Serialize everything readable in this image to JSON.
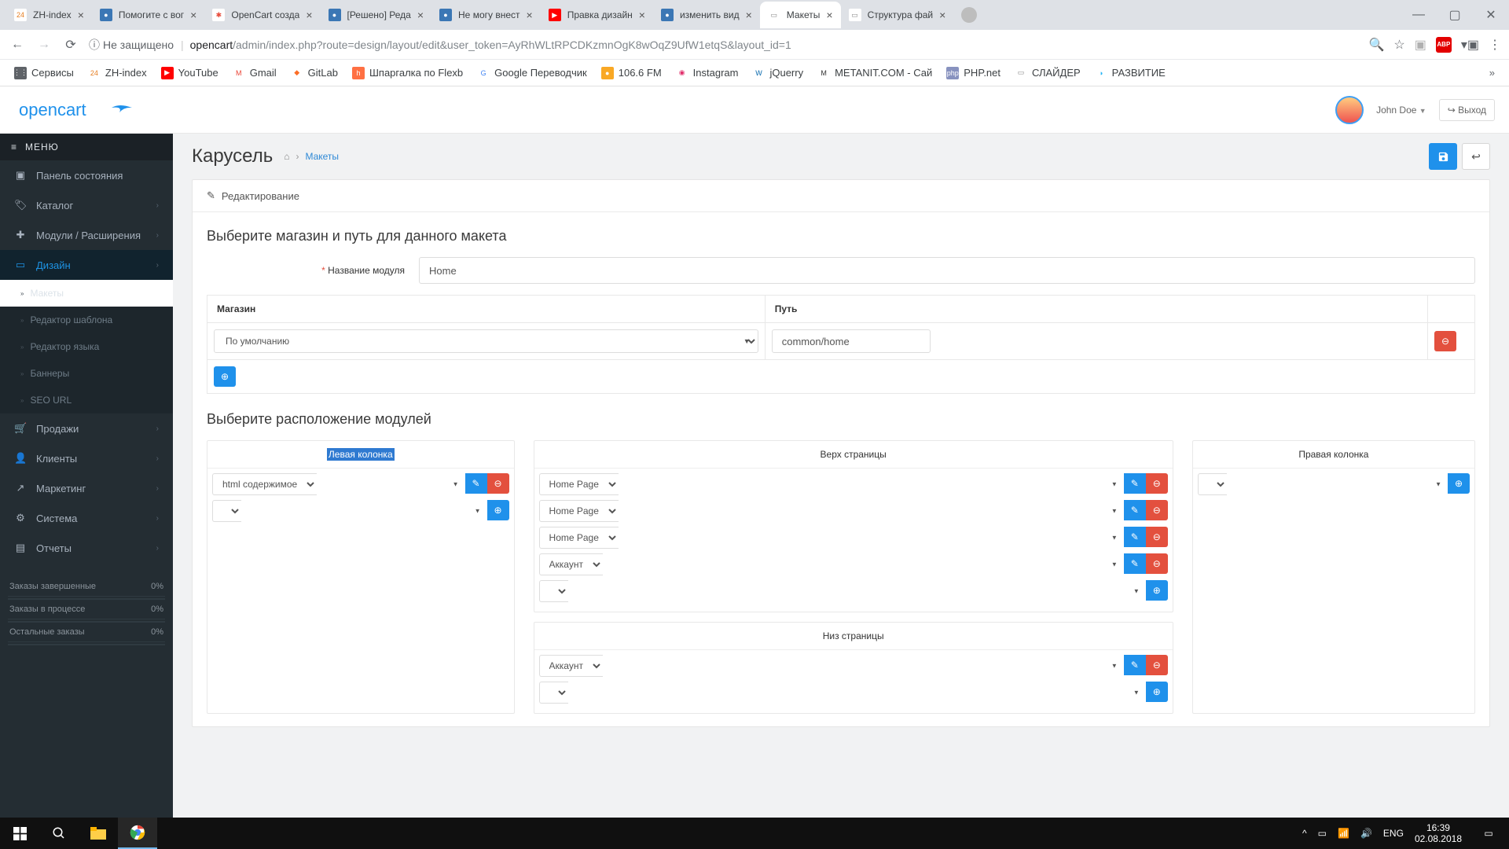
{
  "browser": {
    "tabs": [
      {
        "title": "ZH-index",
        "favBg": "#ffffff",
        "favTxt": "24",
        "favColor": "#e67e22"
      },
      {
        "title": "Помогите с вог",
        "favBg": "#3b77b5",
        "favTxt": "●",
        "favColor": "#fff"
      },
      {
        "title": "OpenCart созда",
        "favBg": "#ffffff",
        "favTxt": "✱",
        "favColor": "#e74c3c"
      },
      {
        "title": "[Решено] Реда",
        "favBg": "#3b77b5",
        "favTxt": "●",
        "favColor": "#fff"
      },
      {
        "title": "Не могу внест",
        "favBg": "#3b77b5",
        "favTxt": "●",
        "favColor": "#fff"
      },
      {
        "title": "Правка дизайн",
        "favBg": "#ff0000",
        "favTxt": "▶",
        "favColor": "#fff"
      },
      {
        "title": "изменить вид",
        "favBg": "#3b77b5",
        "favTxt": "●",
        "favColor": "#fff"
      },
      {
        "title": "Макеты",
        "favBg": "#ffffff",
        "favTxt": "▭",
        "favColor": "#888",
        "active": true
      },
      {
        "title": "Структура фай",
        "favBg": "#ffffff",
        "favTxt": "▭",
        "favColor": "#888"
      }
    ],
    "insecureLabel": "Не защищено",
    "urlHost": "opencart",
    "urlPath": "/admin/index.php?route=design/layout/edit&user_token=AyRhWLtRPCDKzmnOgK8wOqZ9UfW1etqS&layout_id=1",
    "bookmarks": [
      {
        "label": "Сервисы",
        "bg": "#5f6368",
        "txt": "⋮⋮"
      },
      {
        "label": "ZH-index",
        "bg": "#ffffff",
        "txt": "24",
        "color": "#e67e22"
      },
      {
        "label": "YouTube",
        "bg": "#ff0000",
        "txt": "▶"
      },
      {
        "label": "Gmail",
        "bg": "#ffffff",
        "txt": "M",
        "color": "#ea4335"
      },
      {
        "label": "GitLab",
        "bg": "#ffffff",
        "txt": "◆",
        "color": "#fc6d26"
      },
      {
        "label": "Шпаргалка по Flexb",
        "bg": "#ff7043",
        "txt": "h"
      },
      {
        "label": "Google Переводчик",
        "bg": "#ffffff",
        "txt": "G",
        "color": "#4285f4"
      },
      {
        "label": "106.6 FM",
        "bg": "#f9a825",
        "txt": "●"
      },
      {
        "label": "Instagram",
        "bg": "#ffffff",
        "txt": "◉",
        "color": "#e1306c"
      },
      {
        "label": "jQuerry",
        "bg": "#ffffff",
        "txt": "W",
        "color": "#0769ad"
      },
      {
        "label": "METANIT.COM - Сай",
        "bg": "#ffffff",
        "txt": "M",
        "color": "#333"
      },
      {
        "label": "PHP.net",
        "bg": "#8892bf",
        "txt": "php"
      },
      {
        "label": "СЛАЙДЕР",
        "bg": "#ffffff",
        "txt": "▭",
        "color": "#888"
      },
      {
        "label": "РАЗВИТИЕ",
        "bg": "#ffffff",
        "txt": "◑",
        "color": "#29b6f6"
      }
    ]
  },
  "oc": {
    "userName": "John Doe",
    "logout": "Выход",
    "menuLabel": "МЕНЮ",
    "nav": [
      {
        "icon": "▣",
        "label": "Панель состояния"
      },
      {
        "icon": "🏷",
        "label": "Каталог",
        "chev": true
      },
      {
        "icon": "✚",
        "label": "Модули / Расширения",
        "chev": true
      },
      {
        "icon": "▭",
        "label": "Дизайн",
        "chev": true,
        "open": true
      },
      {
        "icon": "🛒",
        "label": "Продажи",
        "chev": true
      },
      {
        "icon": "👤",
        "label": "Клиенты",
        "chev": true
      },
      {
        "icon": "↗",
        "label": "Маркетинг",
        "chev": true
      },
      {
        "icon": "⚙",
        "label": "Система",
        "chev": true
      },
      {
        "icon": "▤",
        "label": "Отчеты",
        "chev": true
      }
    ],
    "designSub": [
      {
        "label": "Макеты",
        "sel": true
      },
      {
        "label": "Редактор шаблона"
      },
      {
        "label": "Редактор языка"
      },
      {
        "label": "Баннеры"
      },
      {
        "label": "SEO URL"
      }
    ],
    "stats": [
      {
        "label": "Заказы завершенные",
        "val": "0%"
      },
      {
        "label": "Заказы в процессе",
        "val": "0%"
      },
      {
        "label": "Остальные заказы",
        "val": "0%"
      }
    ]
  },
  "page": {
    "title": "Карусель",
    "bcLink": "Макеты",
    "panelTitle": "Редактирование",
    "section1": "Выберите магазин и путь для данного макета",
    "nameLabel": "Название модуля",
    "nameValue": "Home",
    "thStore": "Магазин",
    "thPath": "Путь",
    "storeVal": "По умолчанию",
    "pathVal": "common/home",
    "section2": "Выберите расположение модулей",
    "leftTitle": "Левая колонка",
    "topTitle": "Верх страницы",
    "rightTitle": "Правая колонка",
    "bottomTitle": "Низ страницы",
    "leftMods": [
      "html содержимое"
    ],
    "topMods": [
      "Home Page",
      "Home Page",
      "Home Page",
      "Аккаунт"
    ],
    "bottomMods": [
      "Аккаунт"
    ]
  },
  "taskbar": {
    "lang": "ENG",
    "time": "16:39",
    "date": "02.08.2018"
  }
}
